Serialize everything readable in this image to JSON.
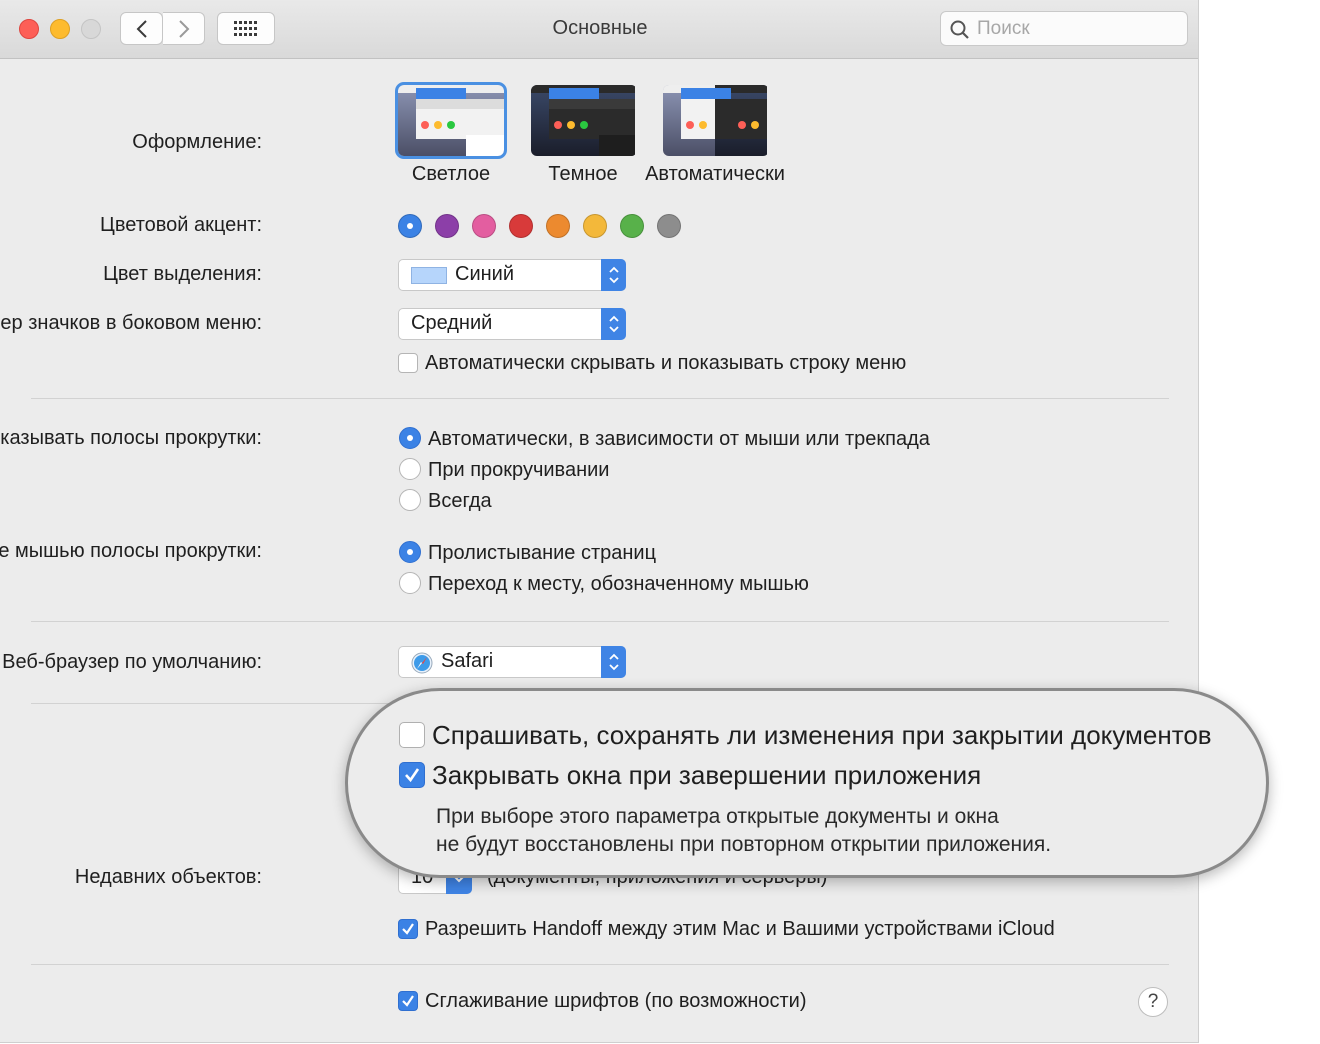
{
  "window": {
    "title": "Основные"
  },
  "toolbar": {
    "search_placeholder": "Поиск"
  },
  "appearance": {
    "label": "Оформление:",
    "options": [
      {
        "label": "Светлое",
        "selected": true
      },
      {
        "label": "Темное",
        "selected": false
      },
      {
        "label": "Автоматически",
        "selected": false
      }
    ]
  },
  "accent": {
    "label": "Цветовой акцент:",
    "colors": [
      "#3b82e5",
      "#8c3fa8",
      "#e35ea0",
      "#d83a3a",
      "#ec8a2f",
      "#f3b83a",
      "#58b14a",
      "#8d8d8d"
    ],
    "selected_index": 0
  },
  "highlight": {
    "label": "Цвет выделения:",
    "value": "Синий",
    "swatch_color": "#b6d5fb"
  },
  "sidebar_icons": {
    "label": "Размер значков в боковом меню:",
    "value": "Средний"
  },
  "menubar": {
    "label": "Автоматически скрывать и показывать строку меню",
    "checked": false
  },
  "scrollbars": {
    "label": "Показывать полосы прокрутки:",
    "options": [
      {
        "label": "Автоматически, в зависимости от мыши или трекпада",
        "selected": true
      },
      {
        "label": "При прокручивании",
        "selected": false
      },
      {
        "label": "Всегда",
        "selected": false
      }
    ]
  },
  "click_scrollbar": {
    "label": "Нажатие мышью полосы прокрутки:",
    "options": [
      {
        "label": "Пролистывание страниц",
        "selected": true
      },
      {
        "label": "Переход к месту, обозначенному мышью",
        "selected": false
      }
    ]
  },
  "browser": {
    "label": "Веб-браузер по умолчанию:",
    "value": "Safari"
  },
  "callout": {
    "ask_save": {
      "label": "Спрашивать, сохранять ли изменения при закрытии документов",
      "checked": false
    },
    "close_windows": {
      "label": "Закрывать окна при завершении приложения",
      "checked": true
    },
    "note_line1": "При выборе этого параметра открытые документы и окна",
    "note_line2": "не будут восстановлены при повторном открытии приложения."
  },
  "recent": {
    "label": "Недавних объектов:",
    "value": "10",
    "suffix": "(документы, приложения и серверы)"
  },
  "handoff": {
    "label": "Разрешить Handoff между этим Mac и Вашими устройствами iCloud",
    "checked": true
  },
  "smoothing": {
    "label": "Сглаживание шрифтов (по возможности)",
    "checked": true
  },
  "help": {
    "label": "?"
  }
}
